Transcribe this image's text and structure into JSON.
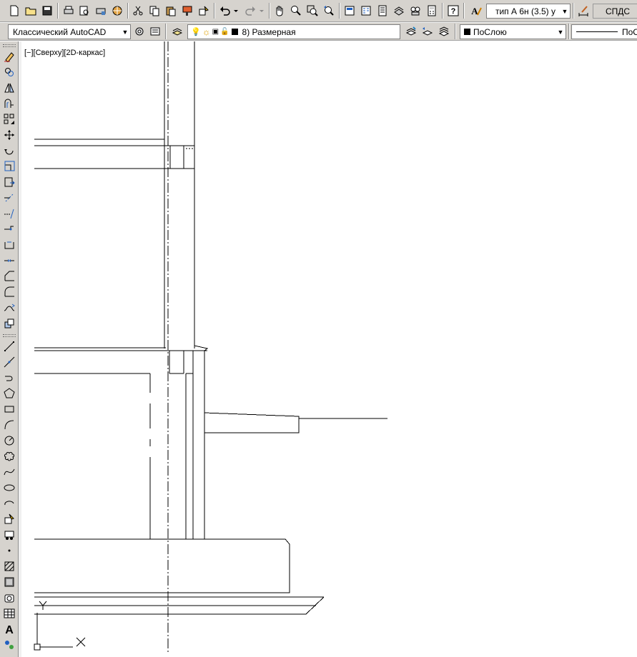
{
  "toolbar1": {
    "text_style": "тип А 6н (3.5) у",
    "spds_label": "СПДС"
  },
  "toolbar2": {
    "workspace": "Классический AutoCAD",
    "layer": "8) Размерная",
    "color": "ПоСлою",
    "linetype": "ПоСл"
  },
  "viewport": {
    "label": "[−][Сверху][2D-каркас]"
  },
  "colors": {
    "toolbar_bg": "#d6d3ce",
    "canvas_bg": "#ffffff",
    "drawing_line": "#000000",
    "layer_swatch": "#000000"
  }
}
